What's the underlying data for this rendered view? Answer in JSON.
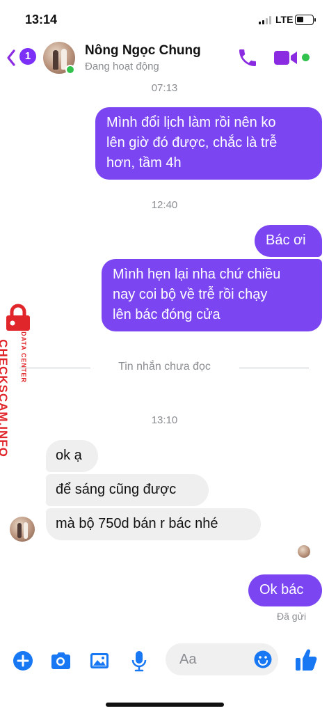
{
  "status_bar": {
    "time": "13:14",
    "network": "LTE"
  },
  "header": {
    "unread_count": "1",
    "contact_name": "Nông Ngọc Chung",
    "presence": "Đang hoạt động"
  },
  "messages": {
    "ts_1": "07:13",
    "out_1": [
      "Mình đổi lịch làm rồi nên ko",
      "lên giờ đó được, chắc là trễ",
      "hơn, tầm 4h"
    ],
    "ts_2": "12:40",
    "out_2": [
      "Bác ơi"
    ],
    "out_3": [
      "Mình hẹn lại nha chứ chiều",
      "nay coi bộ về trễ rồi chạy",
      "lên bác đóng cửa"
    ],
    "unread_divider": "Tin nhắn chưa đọc",
    "ts_3": "13:10",
    "in_1": "ok ạ",
    "in_2": "để sáng cũng được",
    "in_3": "mà bộ 750d bán r bác nhé",
    "out_4": "Ok bác",
    "sent_status": "Đã gửi"
  },
  "watermark": {
    "brand": "CHECKSCAM.INFO",
    "sub": "DATA CENTER"
  },
  "composer": {
    "placeholder": "Aa"
  },
  "colors": {
    "accent": "#7b45f2",
    "incoming_bubble": "#efefef",
    "icon_blue": "#1877f2",
    "header_purple": "#8a2be2",
    "online_green": "#31c24d"
  },
  "icons": [
    "back-chevron-icon",
    "phone-icon",
    "video-camera-icon",
    "plus-icon",
    "camera-icon",
    "image-icon",
    "microphone-icon",
    "emoji-icon",
    "thumbs-up-icon",
    "lock-icon"
  ]
}
